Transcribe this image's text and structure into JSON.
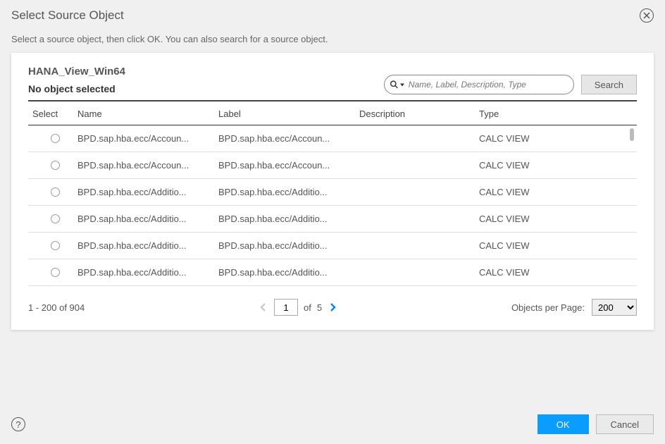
{
  "dialog": {
    "title": "Select Source Object",
    "instruction": "Select a source object, then click OK. You can also search for a source object."
  },
  "panel": {
    "source_name": "HANA_View_Win64",
    "selection_status": "No object selected",
    "search": {
      "placeholder": "Name, Label, Description, Type",
      "button": "Search"
    },
    "columns": {
      "select": "Select",
      "name": "Name",
      "label": "Label",
      "description": "Description",
      "type": "Type"
    },
    "rows": [
      {
        "name": "BPD.sap.hba.ecc/Accoun...",
        "label": "BPD.sap.hba.ecc/Accoun...",
        "description": "",
        "type": "CALC VIEW"
      },
      {
        "name": "BPD.sap.hba.ecc/Accoun...",
        "label": "BPD.sap.hba.ecc/Accoun...",
        "description": "",
        "type": "CALC VIEW"
      },
      {
        "name": "BPD.sap.hba.ecc/Additio...",
        "label": "BPD.sap.hba.ecc/Additio...",
        "description": "",
        "type": "CALC VIEW"
      },
      {
        "name": "BPD.sap.hba.ecc/Additio...",
        "label": "BPD.sap.hba.ecc/Additio...",
        "description": "",
        "type": "CALC VIEW"
      },
      {
        "name": "BPD.sap.hba.ecc/Additio...",
        "label": "BPD.sap.hba.ecc/Additio...",
        "description": "",
        "type": "CALC VIEW"
      },
      {
        "name": "BPD.sap.hba.ecc/Additio...",
        "label": "BPD.sap.hba.ecc/Additio...",
        "description": "",
        "type": "CALC VIEW"
      }
    ]
  },
  "pagination": {
    "range_text": "1 - 200 of 904",
    "current_page": "1",
    "of_label": "of",
    "total_pages": "5",
    "per_page_label": "Objects per Page:",
    "per_page_value": "200"
  },
  "footer": {
    "ok": "OK",
    "cancel": "Cancel",
    "help": "?"
  }
}
